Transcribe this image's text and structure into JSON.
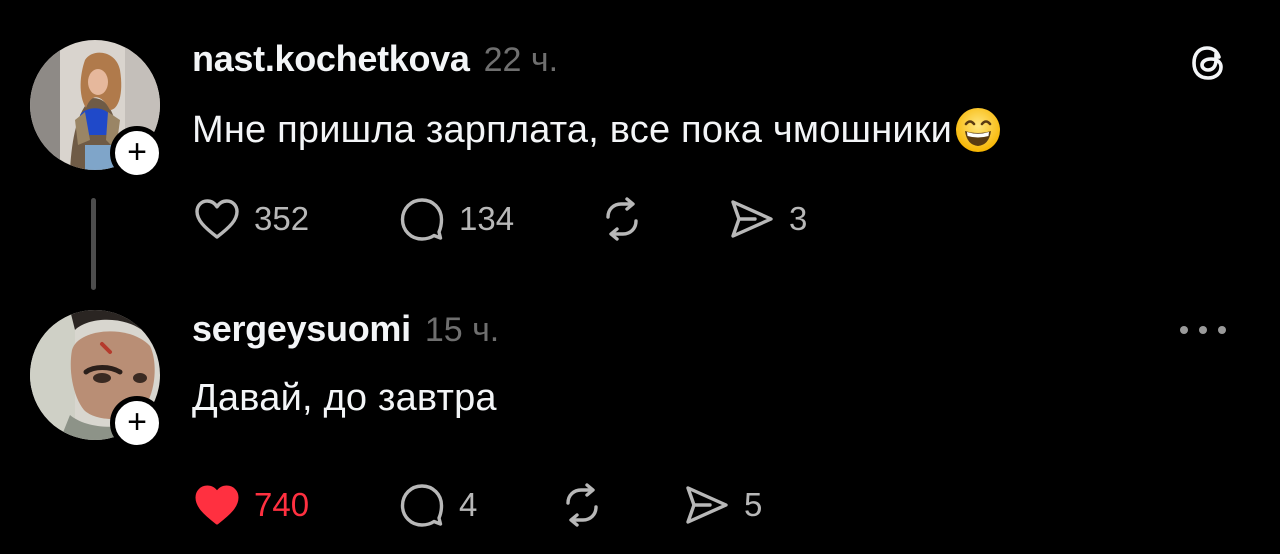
{
  "posts": [
    {
      "username": "nast.kochetkova",
      "time": "22 ч.",
      "text": "Мне пришла зарплата, все пока чмошники",
      "emoji": "grinning-face-with-smiling-eyes",
      "likes": "352",
      "replies": "134",
      "shares": "3",
      "liked": false,
      "follow_label": "+",
      "corner_icon": "threads-logo-icon"
    },
    {
      "username": "sergeysuomi",
      "time": "15 ч.",
      "text": "Давай, до завтра",
      "likes": "740",
      "replies": "4",
      "shares": "5",
      "liked": true,
      "follow_label": "+",
      "corner_icon": "more-options-icon"
    }
  ],
  "colors": {
    "background": "#000000",
    "text": "#f3f5f7",
    "muted": "#6f6f6f",
    "icon": "#b8b8b8",
    "like_active": "#ff3040",
    "thread_line": "#4d4d4d"
  }
}
